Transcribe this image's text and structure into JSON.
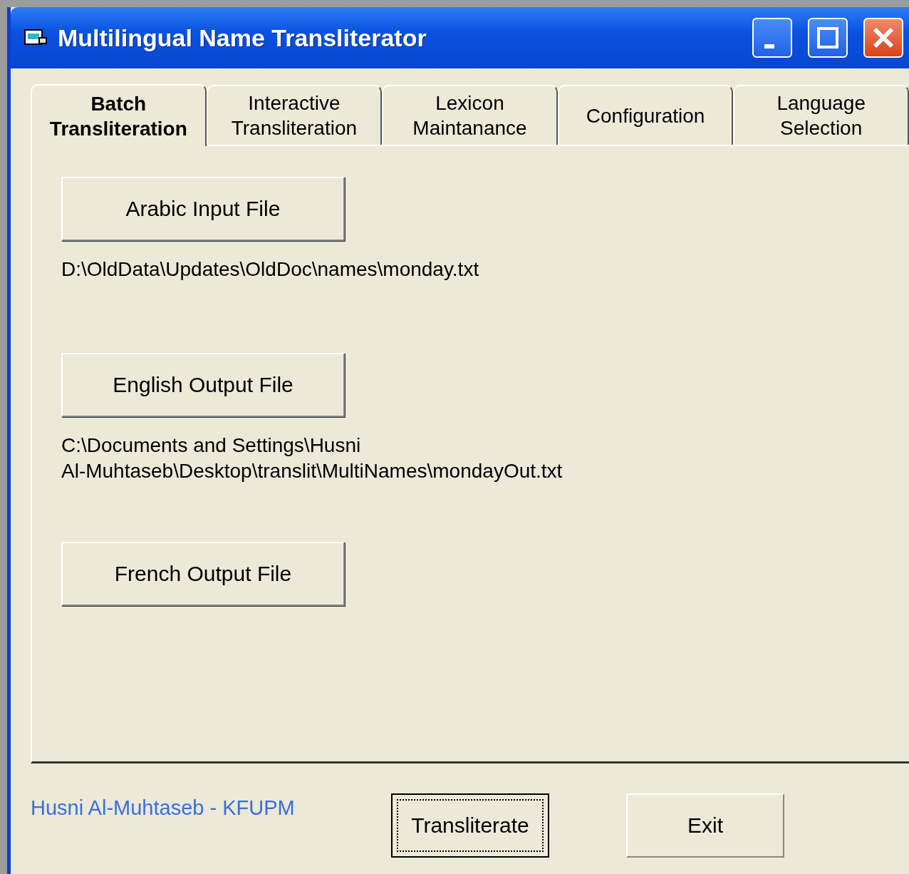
{
  "window": {
    "title": "Multilingual Name Transliterator"
  },
  "tabs": [
    {
      "label": "Batch Transliteration",
      "selected": true
    },
    {
      "label": "Interactive Transliteration",
      "selected": false
    },
    {
      "label": "Lexicon Maintanance",
      "selected": false
    },
    {
      "label": "Configuration",
      "selected": false
    },
    {
      "label": "Language Selection",
      "selected": false
    }
  ],
  "files": [
    {
      "button": "Arabic Input File",
      "path": "D:\\OldData\\Updates\\OldDoc\\names\\monday.txt"
    },
    {
      "button": "English Output File",
      "path": "C:\\Documents and Settings\\Husni Al-Muhtaseb\\Desktop\\translit\\MultiNames\\mondayOut.txt"
    },
    {
      "button": "French Output File"
    }
  ],
  "footer": {
    "author": "Husni Al-Muhtaseb - KFUPM",
    "buttons": [
      {
        "label": "Transliterate",
        "focused": true
      },
      {
        "label": "Exit",
        "focused": false
      }
    ]
  }
}
